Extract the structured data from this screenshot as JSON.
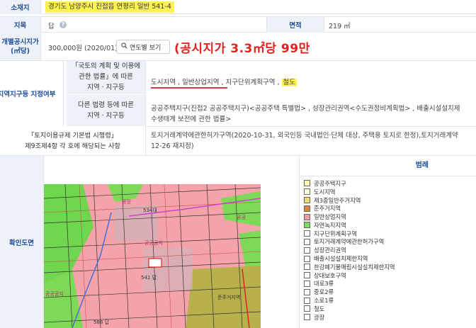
{
  "location": {
    "header": "소재지",
    "value": "경기도 남양주시 진접읍 연평리 일반 541-4"
  },
  "land": {
    "category_header": "지목",
    "category_value": "답",
    "area_header": "면적",
    "area_value": "219 ㎡"
  },
  "price": {
    "header": "개별공시지가\n(㎡당)",
    "value": "300,000원 (2020/01)",
    "yearly_button": "연도별 보기",
    "annotation": "(공시지가 3.3㎡당 99만"
  },
  "zoning": {
    "header": "지역지구등 지정여부",
    "law1_header": "「국토의 계획 및 이용에\n관한 법률」에 따른\n지역ㆍ지구등",
    "law1_items": [
      "도시지역",
      "일반상업지역",
      "지구단위계획구역",
      "철도"
    ],
    "law2_header": "다른 법령 등에 따른\n지역ㆍ지구등",
    "law2_value": "공공주택지구(진접2 공공주택지구)<공공주택 특별법> , 성장관리권역<수도권정비계획법> , 배출시설설치제\n수생태계 보전에 관한 법률>"
  },
  "enforcement": {
    "header": "「토지이용규제 기본법 시행령」\n제9조제4항 각 호에 해당되는 사항",
    "value": "토지거래계약에관한허가구역(2020-10-31, 외국인등 국내법인·단체 대상, 주택용 토지로 한정),토지거래계약\n12-26 재지정)"
  },
  "map": {
    "header": "확인도면",
    "labels": [
      "534대",
      "541 답",
      "공공",
      "광장",
      "공공공지",
      "준주거지역",
      "588 답",
      "공공공지"
    ]
  },
  "legend": {
    "title": "범례",
    "items": [
      {
        "label": "공공주택지구",
        "color": "#fff7b3"
      },
      {
        "label": "도시지역",
        "color": "#ffffd9"
      },
      {
        "label": "제3종일반주거지역",
        "color": "#f2dc6b"
      },
      {
        "label": "준주거지역",
        "color": "#d58a3a"
      },
      {
        "label": "일반상업지역",
        "color": "#f49aa4"
      },
      {
        "label": "자연녹지지역",
        "color": "#7ed957"
      },
      {
        "label": "지구단위계획구역",
        "color": "#ffffff"
      },
      {
        "label": "토지거래계약에관한허가구역",
        "color": "#ffffff"
      },
      {
        "label": "성장관리권역",
        "color": "#ffffff"
      },
      {
        "label": "배출시설설치제한지역",
        "color": "#ffffff"
      },
      {
        "label": "한강폐기물매립시설설치제한지역",
        "color": "#ffffff"
      },
      {
        "label": "상대보호구역",
        "color": "#ffffff"
      },
      {
        "label": "대로3류",
        "color": "#ffffff"
      },
      {
        "label": "중로2류",
        "color": "#ffffff"
      },
      {
        "label": "소로1류",
        "color": "#ffffff"
      },
      {
        "label": "철도",
        "color": "#ffffff"
      },
      {
        "label": "광장",
        "color": "#ffffff"
      }
    ]
  },
  "colors": {
    "header_bg": "#eef2f8",
    "header_text": "#1f4e9c",
    "highlight": "#fff44f",
    "annotation": "#e52020"
  }
}
